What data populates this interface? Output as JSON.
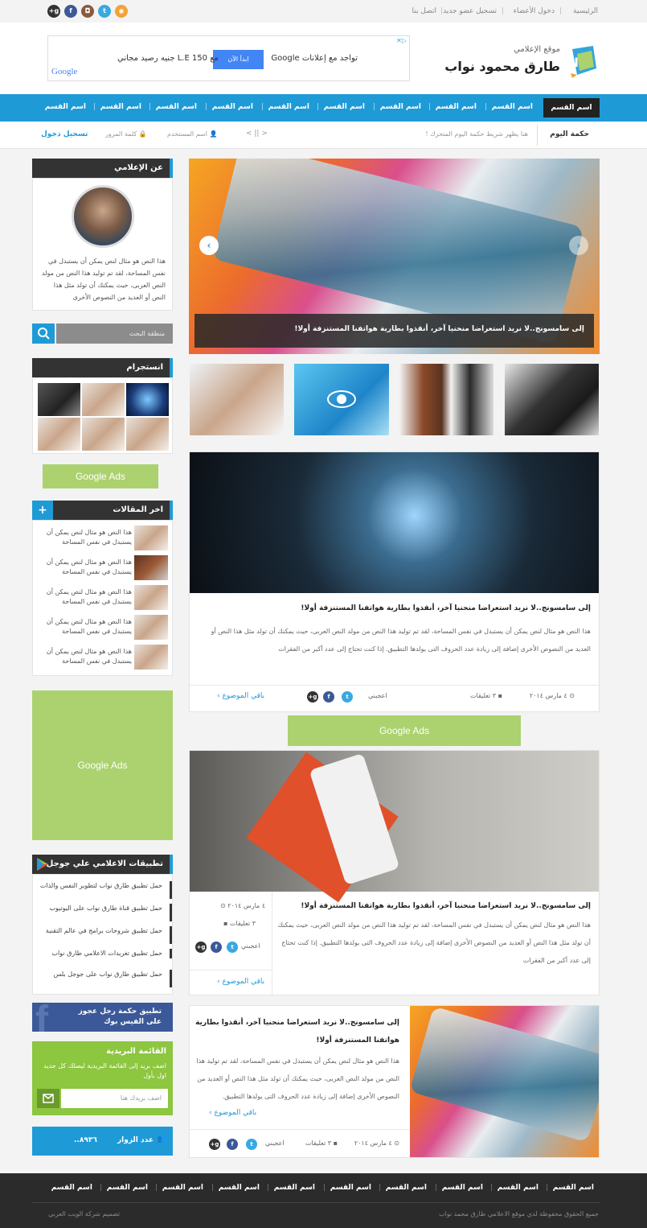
{
  "topbar": {
    "links": [
      "الرئيسية",
      "دخول الأعضاء",
      "تسجيل عضو جديد",
      "اتصل بنا"
    ],
    "social_icons": [
      "google-plus-icon",
      "facebook-icon",
      "instagram-icon",
      "twitter-icon",
      "rss-icon"
    ],
    "social_labels": [
      "g+",
      "f",
      "◘",
      "t",
      "◉"
    ]
  },
  "header": {
    "logo_subtitle": "موقع الإعلامي",
    "logo_title": "طارق محمود نواب",
    "ad_text": "تواجد مع إعلانات Google",
    "ad_button": "ابدأ الآن",
    "ad_offer": "مع L.E 150 جنيه رصيد مجاني",
    "ad_brand": "Google"
  },
  "nav": {
    "items": [
      "اسم القسم",
      "اسم القسم",
      "اسم القسم",
      "اسم القسم",
      "اسم القسم",
      "اسم القسم",
      "اسم القسم",
      "اسم القسم",
      "اسم القسم",
      "اسم القسم"
    ]
  },
  "ticker": {
    "label": "حكمة اليوم",
    "text": "هنا يظهر شريط حكمة اليوم المتحرك !",
    "controls": "< || >",
    "username_placeholder": "اسم المستخدم",
    "password_placeholder": "كلمة المرور",
    "login_label": "تسجيل دخول"
  },
  "sidebar": {
    "about_title": "عن الإعلامي",
    "about_text": "هذا النص هو مثال لنص يمكن أن يستبدل في نفس المساحة، لقد تم توليد هذا النص من مولد النص العربى، حيث يمكنك أن تولد مثل هذا النص أو العديد من النصوص الأخرى",
    "search_placeholder": "منطقة البحث",
    "instagram_title": "انستجرام",
    "google_ads": "Google Ads",
    "recent_title": "اخر المقالات",
    "recent_items": [
      "هذا النص هو مثال لنص يمكن أن يستبدل في نفس المساحة",
      "هذا النص هو مثال لنص يمكن أن يستبدل في نفس المساحة",
      "هذا النص هو مثال لنص يمكن أن يستبدل في نفس المساحة",
      "هذا النص هو مثال لنص يمكن أن يستبدل في نفس المساحة",
      "هذا النص هو مثال لنص يمكن أن يستبدل في نفس المساحة"
    ],
    "big_ads": "Google Ads",
    "apps_title": "تطبيقات الاعلامي علي جوجل بلاي",
    "apps": [
      "حمل تطبيق طارق نواب لتطوير النفس والذات",
      "حمل تطبيق قناة طارق نواب على اليوتيوب",
      "حمل تطبيق شروحات برامج في عالم التقنية",
      "حمل تطبيق تغريدات الاعلامي طارق نواب",
      "حمل تطبيق طارق نواب على جوجل بلس"
    ],
    "facebook_text": "تطبيق حكمة رجل عجوز على الفيس بوك",
    "newsletter_title": "القائمة البريدية",
    "newsletter_text": "اضف بريد إلى القائمة البريدية ليصلك كل جديد اول بأول",
    "newsletter_placeholder": "اضف بريدك هنا",
    "visitors_label": "عدد الزوار",
    "visitors_count": "٨٩٣٦.."
  },
  "main": {
    "slider_caption": "إلى سامسونج..لا نريد استعراضا منحنيا آخر، أنقذوا بطارية هواتفنا المستنزفة أولا!",
    "post1": {
      "title": "إلى سامسونج..لا نريد استعراضا منحنيا آخر، أنقذوا بطارية هواتفنا المستنزفة أولا!",
      "excerpt": "هذا النص هو مثال لنص يمكن أن يستبدل في نفس المساحة، لقد تم توليد هذا النص من مولد النص العربى، حيث يمكنك أن تولد مثل هذا النص أو العديد من النصوص الأخرى إضافة إلى زيادة عدد الحروف التى يولدها التطبيق. إذا كنت تحتاج إلى عدد أكبر من الفقرات",
      "date": "٤ مارس ٢٠١٤",
      "comments": "٣ تعليقات",
      "like": "اعجبني",
      "more": "باقي الموضوع ›"
    },
    "mid_ads": "Google Ads",
    "post2": {
      "title": "إلى سامسونج..لا نريد استعراضا منحنيا آخر، أنقذوا بطارية هواتفنا المستنزفة أولا!",
      "excerpt": "هذا النص هو مثال لنص يمكن أن يستبدل في نفس المساحة، لقد تم توليد هذا النص من مولد النص العربى، حيث يمكنك أن تولد مثل هذا النص أو العديد من النصوص الأخرى إضافة إلى زيادة عدد الحروف التى يولدها التطبيق. إذا كنت تحتاج إلى عدد أكبر من الفقرات",
      "date": "٤ مارس ٢٠١٤",
      "comments": "٣ تعليقات",
      "like": "اعجبني",
      "more": "باقي الموضوع ›"
    },
    "post3": {
      "title": "إلى سامسونج..لا نريد استعراضا منحنيا آخر، أنقذوا بطارية هواتفنا المستنزفة أولا!",
      "excerpt": "هذا النص هو مثال لنص يمكن أن يستبدل في نفس المساحة، لقد تم توليد هذا النص من مولد النص العربى، حيث يمكنك أن تولد مثل هذا النص أو العديد من النصوص الأخرى إضافة إلى زيادة عدد الحروف التى يولدها التطبيق.",
      "more": "باقي الموضوع ›",
      "date": "٤ مارس ٢٠١٤",
      "comments": "٣ تعليقات",
      "like": "اعجبني"
    }
  },
  "footer": {
    "nav_items": [
      "اسم القسم",
      "اسم القسم",
      "اسم القسم",
      "اسم القسم",
      "اسم القسم",
      "اسم القسم",
      "اسم القسم",
      "اسم القسم",
      "اسم القسم",
      "اسم القسم"
    ],
    "copyright": "جميع الحقوق محفوظة لدي موقع الاعلامي طارق محمد نواب",
    "designer": "تصميم شركة الويب العربي"
  },
  "colors": {
    "accent": "#1e9bd7",
    "dark": "#333333",
    "ads_green": "#abd26e",
    "newsletter_green": "#8dc63f",
    "facebook_blue": "#3b5998"
  }
}
